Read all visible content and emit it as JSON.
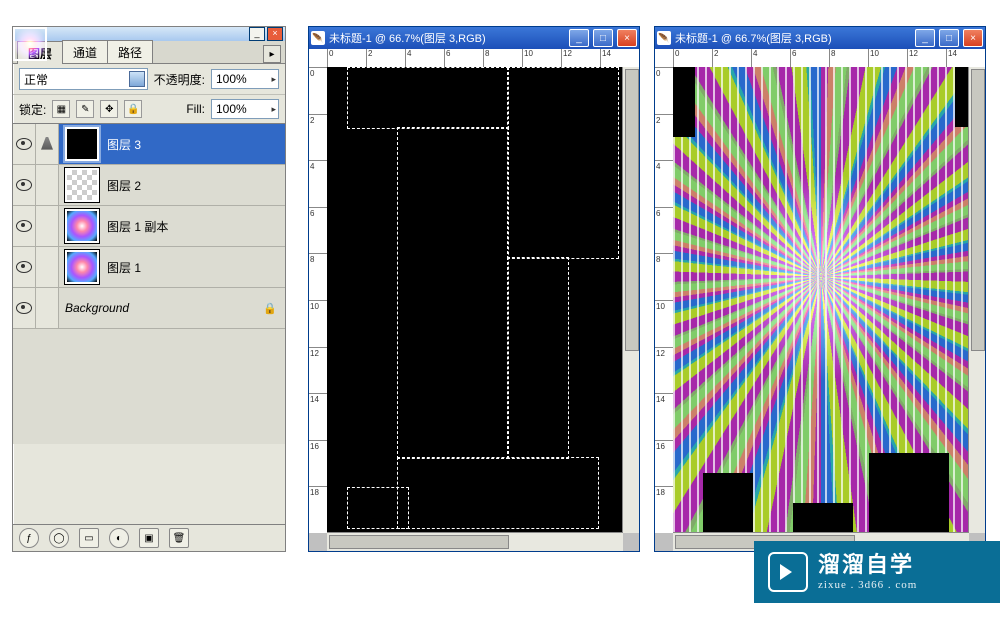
{
  "panel": {
    "tabs": {
      "layers": "图层",
      "channels": "通道",
      "paths": "路径"
    },
    "blend_mode_label": "正常",
    "opacity_label": "不透明度:",
    "opacity_value": "100%",
    "lock_label": "锁定:",
    "fill_label": "Fill:",
    "fill_value": "100%",
    "layers": [
      {
        "name": "图层 3",
        "selected": true,
        "thumb": "black"
      },
      {
        "name": "图层 2",
        "selected": false,
        "thumb": "trans"
      },
      {
        "name": "图层 1 副本",
        "selected": false,
        "thumb": "effect"
      },
      {
        "name": "图层 1",
        "selected": false,
        "thumb": "effect"
      },
      {
        "name": "Background",
        "selected": false,
        "thumb": "burst",
        "bg": true,
        "locked": true
      }
    ]
  },
  "doc": {
    "title": "未标题-1 @ 66.7%(图层 3,RGB)",
    "ruler_h": [
      "0",
      "2",
      "4",
      "6",
      "8",
      "10",
      "12",
      "14"
    ],
    "ruler_v": [
      "0",
      "2",
      "4",
      "6",
      "8",
      "10",
      "12",
      "14",
      "16",
      "18"
    ]
  },
  "watermark": {
    "title": "溜溜自学",
    "sub": "zixue . 3d66 . com"
  }
}
